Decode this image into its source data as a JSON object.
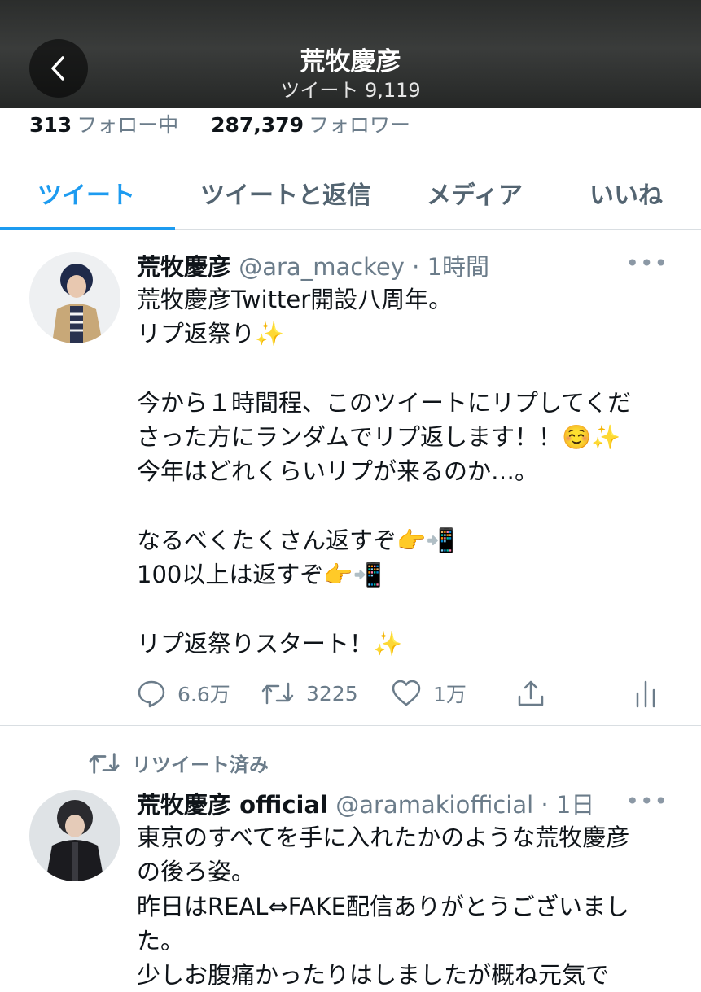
{
  "header": {
    "title": "荒牧慶彦",
    "subtitle": "ツイート 9,119"
  },
  "profile": {
    "following_count": "313",
    "following_label": "フォロー中",
    "followers_count": "287,379",
    "followers_label": "フォロワー"
  },
  "tabs": [
    {
      "label": "ツイート",
      "active": true
    },
    {
      "label": "ツイートと返信",
      "active": false
    },
    {
      "label": "メディア",
      "active": false
    },
    {
      "label": "いいね",
      "active": false
    }
  ],
  "tweets": [
    {
      "name": "荒牧慶彦",
      "handle": "@ara_mackey",
      "time": "1時間",
      "lines": [
        "荒牧慶彦Twitter開設八周年。",
        "リプ返祭り✨",
        "",
        "今から１時間程、このツイートにリプしてくだ",
        "さった方にランダムでリプ返します！！☺️✨",
        "今年はどれくらいリプが来るのか…。",
        "",
        "なるべくたくさん返すぞ👉📲",
        "100以上は返すぞ👉📲",
        "",
        "リプ返祭りスタート！✨"
      ],
      "replies": "6.6万",
      "retweets": "3225",
      "likes": "1万"
    },
    {
      "retweet_label": "リツイート済み",
      "name": "荒牧慶彦 official",
      "handle": "@aramakiofficial",
      "time": "1日",
      "lines": [
        "東京のすべてを手に入れたかのような荒牧慶彦",
        "の後ろ姿。",
        "昨日はREAL⇔FAKE配信ありがとうございまし",
        "た。",
        "少しお腹痛かったりはしましたが概ね元気で"
      ]
    }
  ],
  "colors": {
    "accent": "#1d9bf0",
    "secondary_text": "#6b7c8a",
    "primary_text": "#0f1419"
  }
}
